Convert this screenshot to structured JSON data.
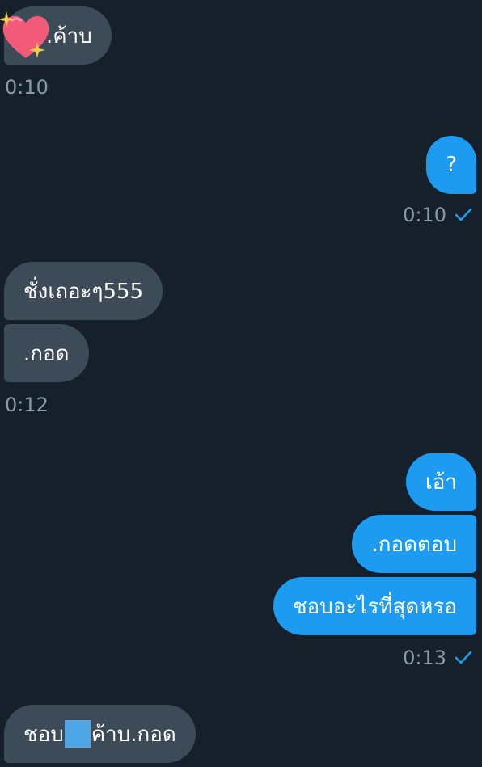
{
  "messages": [
    {
      "id": "m1",
      "side": "received",
      "text": ".ค้าบ",
      "prefix_sticker": "heart-sparkle-sticker"
    },
    {
      "id": "m2",
      "side": "sent",
      "text": "?"
    },
    {
      "id": "m3",
      "side": "received",
      "text": "ชั่งเถอะๆ555"
    },
    {
      "id": "m4",
      "side": "received",
      "text": ".กอด"
    },
    {
      "id": "m5",
      "side": "sent",
      "text": "เอ้า"
    },
    {
      "id": "m6",
      "side": "sent",
      "text": ".กอดตอบ"
    },
    {
      "id": "m7",
      "side": "sent",
      "text": "ชอบอะไรที่สุดหรอ"
    },
    {
      "id": "m8",
      "side": "received",
      "text_before": "ชอบ",
      "text_after": "ค้าบ.กอด",
      "redacted": true
    }
  ],
  "timestamps": {
    "t1": {
      "time": "0:10"
    },
    "t2": {
      "time": "0:10",
      "status_icon": "check-icon"
    },
    "t3": {
      "time": "0:12"
    },
    "t4": {
      "time": "0:13",
      "status_icon": "check-icon"
    }
  },
  "colors": {
    "background": "#15202b",
    "received_bubble": "#3d4b59",
    "sent_bubble": "#1d9bf0",
    "timestamp_text": "#8b98a5",
    "check": "#1d9bf0"
  }
}
